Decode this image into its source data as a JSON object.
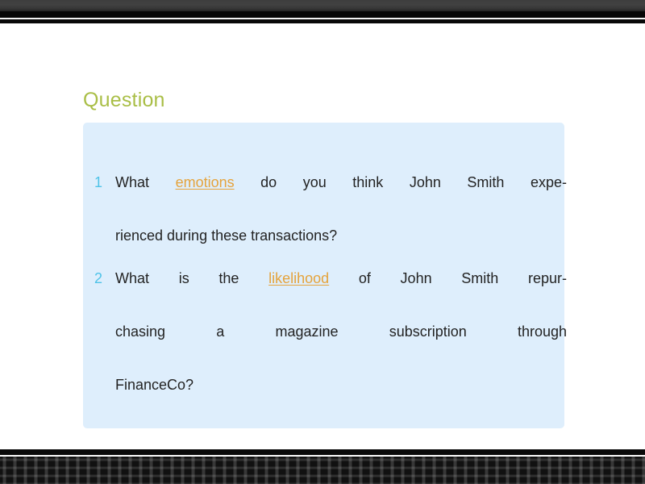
{
  "slide": {
    "title": "Question",
    "title_color": "#A9BE46",
    "panel_color": "#DEEEFC",
    "number_color": "#4FC3E8",
    "keyword_color": "#E5A33C",
    "body_color": "#232323",
    "top_bar_colors": [
      "#3e3e3e",
      "#060606",
      "#f2f2f2",
      "#080808"
    ],
    "bottom_bar_colors": [
      "#0a0a0a",
      "#fbfbfb",
      "#111111"
    ]
  },
  "questions": [
    {
      "number": "1",
      "full_text": "What emotions do you think John Smith experienced during these transactions?",
      "keyword": "emotions",
      "lines": [
        {
          "pre": "What ",
          "kw": "emotions",
          "post": " do you think John Smith expe-",
          "last": false
        },
        {
          "pre": "rienced during these transactions?",
          "kw": "",
          "post": "",
          "last": true
        }
      ]
    },
    {
      "number": "2",
      "full_text": "What is the likelihood of John Smith repurchasing a magazine subscription through FinanceCo?",
      "keyword": "likelihood",
      "lines": [
        {
          "pre": "What is the ",
          "kw": "likelihood",
          "post": " of John Smith repur-",
          "last": false
        },
        {
          "pre": "chasing a magazine subscription through",
          "kw": "",
          "post": "",
          "last": false
        },
        {
          "pre": "FinanceCo?",
          "kw": "",
          "post": "",
          "last": true
        }
      ]
    }
  ]
}
